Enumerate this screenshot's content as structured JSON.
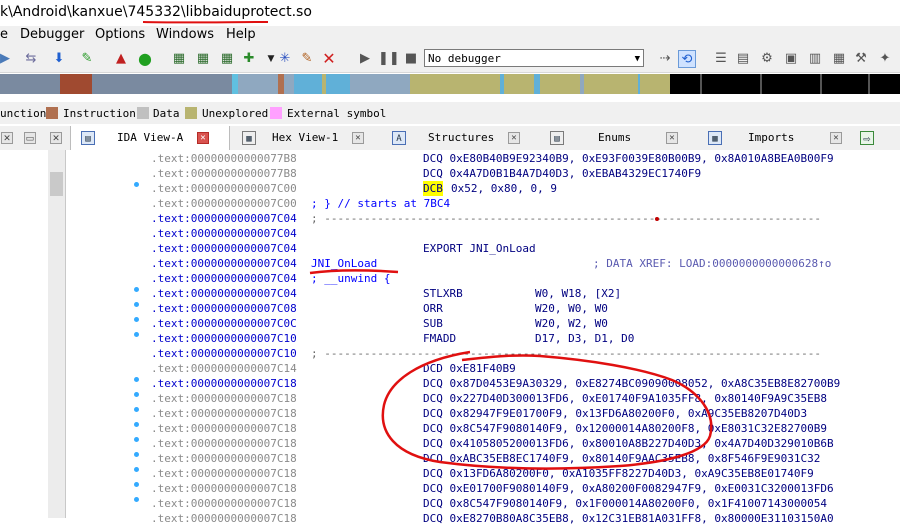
{
  "title": {
    "prefix": "k\\Android\\kanxue\\745332\\",
    "file": "libbaiduprotect.so"
  },
  "menu": [
    "Debugger",
    "Options",
    "Windows",
    "Help"
  ],
  "toolbar": {
    "debugger_selected": "No debugger"
  },
  "legend": [
    {
      "label": "unction",
      "color": "#ffffff"
    },
    {
      "label": "Instruction",
      "color": "#b07050"
    },
    {
      "label": "Data",
      "color": "#c0c0c0"
    },
    {
      "label": "Unexplored",
      "color": "#b8b470"
    },
    {
      "label": "External symbol",
      "color": "#ffa0ff"
    }
  ],
  "tabs": [
    {
      "label": "IDA View-A"
    },
    {
      "label": "Hex View-1"
    },
    {
      "label": "Structures"
    },
    {
      "label": "Enums"
    },
    {
      "label": "Imports"
    }
  ],
  "listing": [
    {
      "addr": ".text:00000000000077B8",
      "code": "DCQ 0xE80B40B9E92340B9, 0xE93F0039E80B00B9, 0x8A010A8BEA0B00F9"
    },
    {
      "addr": ".text:00000000000077B8",
      "code": "DCQ 0x4A7D0B1B4A7D40D3, 0xEBAB4329EC1740F9"
    },
    {
      "addr": ".text:0000000000007C00",
      "code_mn": "DCB",
      "code_ops": "0x52, 0x80, 0, 9"
    },
    {
      "addr": ".text:0000000000007C00",
      "comment": "; } // starts at 7BC4"
    },
    {
      "addr": ".text:0000000000007C04",
      "dashes": "; ---------------------------------------------------------------------------"
    },
    {
      "addr": ".text:0000000000007C04"
    },
    {
      "addr": ".text:0000000000007C04",
      "export": "EXPORT JNI_OnLoad"
    },
    {
      "addr": ".text:0000000000007C04",
      "symbol": "JNI_OnLoad",
      "xref": "; DATA XREF: LOAD:0000000000000628↑o"
    },
    {
      "addr": ".text:0000000000007C04",
      "comment": "; __unwind {"
    },
    {
      "addr": ".text:0000000000007C04",
      "mnem": "STLXRB",
      "ops": "W0, W18, [X2]"
    },
    {
      "addr": ".text:0000000000007C08",
      "mnem": "ORR",
      "ops": "W20, W0, W0"
    },
    {
      "addr": ".text:0000000000007C0C",
      "mnem": "SUB",
      "ops": "W20, W2, W0"
    },
    {
      "addr": ".text:0000000000007C10",
      "mnem": "FMADD",
      "ops": "D17, D3, D1, D0"
    },
    {
      "addr": ".text:0000000000007C10",
      "dashes": "; ---------------------------------------------------------------------------"
    },
    {
      "addr": ".text:0000000000007C14",
      "code": "DCD 0xE81F40B9"
    },
    {
      "addr": ".text:0000000000007C18",
      "code": "DCQ 0x87D0453E9A30329, 0xE8274BC09090008052, 0xA8C35EB8E82700B9"
    },
    {
      "addr": ".text:0000000000007C18",
      "code": "DCQ 0x227D40D300013FD6, 0xE01740F9A1035FF8, 0x80140F9A9C35EB8"
    },
    {
      "addr": ".text:0000000000007C18",
      "code": "DCQ 0x82947F9E01700F9, 0x13FD6A80200F0, 0xA9C35EB8207D40D3"
    },
    {
      "addr": ".text:0000000000007C18",
      "code": "DCQ 0x8C547F9080140F9, 0x12000014A80200F8, 0xE8031C32E82700B9"
    },
    {
      "addr": ".text:0000000000007C18",
      "code": "DCQ 0x4105805200013FD6, 0x80010A8B227D40D3, 0x4A7D40D329010B6B"
    },
    {
      "addr": ".text:0000000000007C18",
      "code": "DCQ 0xABC35EB8EC1740F9, 0x80140F9AAC35EB8, 0x8F546F9E9031C32"
    },
    {
      "addr": ".text:0000000000007C18",
      "code": "DCQ 0x13FD6A80200F0, 0xA1035FF8227D40D3, 0xA9C35EB8E01740F9"
    },
    {
      "addr": ".text:0000000000007C18",
      "code": "DCQ 0xE01700F9080140F9, 0xA80200F0082947F9, 0xE0031C3200013FD6"
    },
    {
      "addr": ".text:0000000000007C18",
      "code": "DCQ 0x8C547F9080140F9, 0x1F000014A80200F0, 0x1F41007143000054"
    },
    {
      "addr": ".text:0000000000007C18",
      "code": "DCQ 0xE8270B80A8C35EB8, 0x12C31EB81A031FF8, 0x80000E31103150A0"
    }
  ]
}
